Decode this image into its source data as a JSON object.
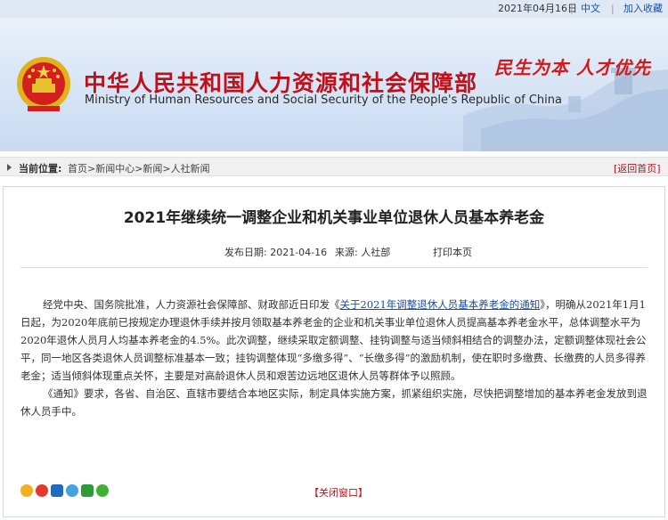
{
  "topbar": {
    "date": "2021年04月16日",
    "lang": "中文",
    "favorite": "加入收藏"
  },
  "header": {
    "title_cn": "中华人民共和国人力资源和社会保障部",
    "title_en": "Ministry of Human Resources and Social Security of the People's Republic of China",
    "slogan": "民生为本  人才优先"
  },
  "breadcrumb": {
    "label": "当前位置:",
    "path": "首页>新闻中心>新闻>人社新闻",
    "back": "[返回首页]"
  },
  "article": {
    "title": "2021年继续统一调整企业和机关事业单位退休人员基本养老金",
    "date": "发布日期:  2021-04-16",
    "source": "来源:  人社部",
    "print": "打印本页",
    "p1_a": "经党中央、国务院批准，人力资源社会保障部、财政部近日印发《",
    "p1_link": "关于2021年调整退休人员基本养老金的通知",
    "p1_b": "》，明确从2021年1月1日起，为2020年底前已按规定办理退休手续并按月领取基本养老金的企业和机关事业单位退休人员提高基本养老金水平，总体调整水平为2020年退休人员月人均基本养老金的4.5%。此次调整，继续采取定额调整、挂钩调整与适当倾斜相结合的调整办法，定额调整体现社会公平，同一地区各类退休人员调整标准基本一致；挂钩调整体现“多缴多得”、“长缴多得”的激励机制，使在职时多缴费、长缴费的人员多得养老金；适当倾斜体现重点关怀，主要是对高龄退休人员和艰苦边远地区退休人员等群体予以照顾。",
    "p2": "《通知》要求，各省、自治区、直辖市要结合本地区实际，制定具体实施方案，抓紧组织实施，尽快把调整增加的基本养老金发放到退休人员手中。",
    "close": "【关闭窗口】"
  },
  "share_icons": [
    "qzone-icon",
    "weibo-icon",
    "renren-icon",
    "tqq-icon",
    "douban-icon",
    "wechat-icon"
  ],
  "colors": {
    "brand_red": "#c0101a",
    "link_blue": "#1a4fa3",
    "header_blue": "#d6e4f5"
  }
}
